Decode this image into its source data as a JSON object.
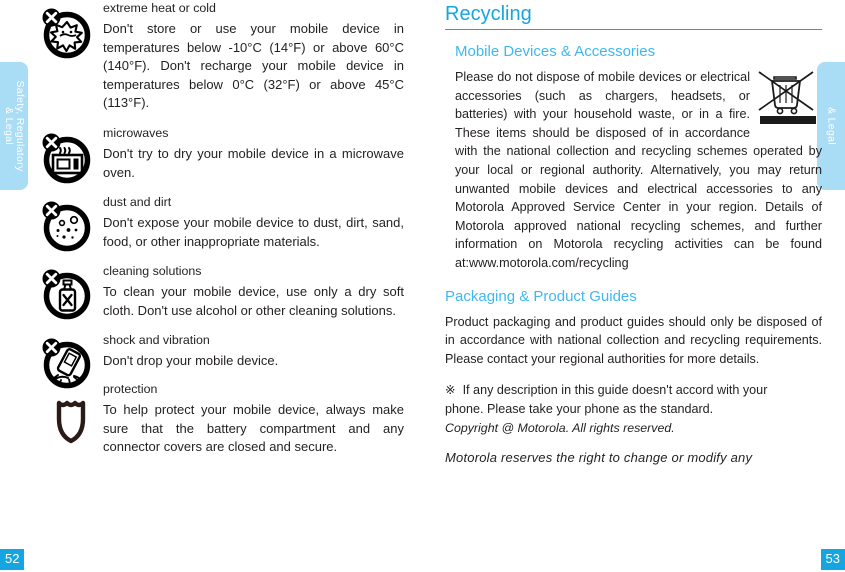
{
  "document": {
    "left_page_number": "52",
    "right_page_number": "53",
    "accent_color": "#15a6e2",
    "tab_color": "#a9dcf5"
  },
  "side_tabs": {
    "left": {
      "line1": "Safety, Regulatory",
      "line2": "& Legal"
    },
    "right": {
      "line1": "& Legal"
    }
  },
  "left_column": {
    "items": [
      {
        "icon": "no-extreme-temperature-icon",
        "title": "extreme heat or cold",
        "body": "Don't store or use your mobile device in temperatures below -10°C (14°F) or above 60°C (140°F). Don't recharge your mobile device in temperatures below 0°C (32°F) or above 45°C (113°F)."
      },
      {
        "icon": "no-microwave-icon",
        "title": "microwaves",
        "body": "Don't try to dry your mobile device in a microwave oven."
      },
      {
        "icon": "no-dust-and-dirt-icon",
        "title": "dust and dirt",
        "body": "Don't expose your mobile device to dust, dirt, sand, food, or other inappropriate materials."
      },
      {
        "icon": "no-cleaning-solutions-icon",
        "title": "cleaning solutions",
        "body": "To clean your mobile device, use only a dry soft cloth. Don't use alcohol or other cleaning solutions."
      },
      {
        "icon": "no-shock-and-vibration-icon",
        "title": "shock and vibration",
        "body": "Don't drop your mobile device."
      },
      {
        "icon": "shield-protection-icon",
        "title": "protection",
        "body": "To help protect your mobile device, always make sure that the battery compartment and any connector covers are closed and secure."
      }
    ]
  },
  "right_column": {
    "heading": "Recycling",
    "section1": {
      "heading": "Mobile Devices & Accessories",
      "icon": "crossed-out-wheelie-bin-icon",
      "body": "Please do not dispose of mobile devices or electrical accessories (such as chargers, headsets, or batteries) with your household waste, or in a fire. These items should be disposed of in accordance with the national collection and recycling schemes operated by your local or regional authority. Alternatively, you may return unwanted mobile devices and electrical accessories to any Motorola Approved Service Center in your region. Details of Motorola approved national recycling schemes, and further information on Motorola recycling activities can be found at:www.motorola.com/recycling"
    },
    "section2": {
      "heading": "Packaging & Product Guides",
      "body": "Product packaging and product guides should only be disposed of in accordance with national collection and recycling requirements. Please contact your regional authorities for more details."
    },
    "note": {
      "marker": "※",
      "line1": "If any description in this guide doesn't accord with your",
      "line2": "phone. Please take your phone as the standard.",
      "copyright": "Copyright @ Motorola. All rights reserved.",
      "tail": "Motorola reserves the right to change or modify any"
    }
  }
}
